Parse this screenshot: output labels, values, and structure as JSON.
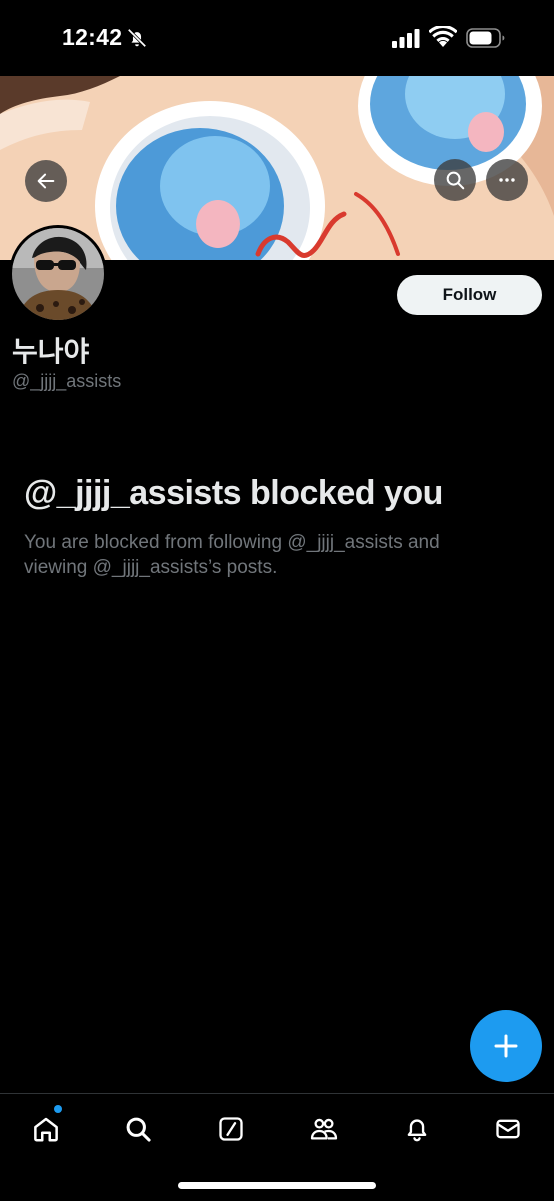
{
  "status_bar": {
    "time": "12:42",
    "icons": [
      "bell-off-icon",
      "cellular-signal-icon",
      "wifi-icon",
      "battery-icon"
    ]
  },
  "header": {
    "back_icon": "arrow-left-icon",
    "search_icon": "search-icon",
    "more_icon": "more-horizontal-icon"
  },
  "profile": {
    "display_name": "누나야",
    "handle": "@_jjjj_assists",
    "follow_label": "Follow"
  },
  "blocked": {
    "title": "@_jjjj_assists blocked you",
    "description": "You are blocked from following @_jjjj_assists and viewing @_jjjj_assists’s posts."
  },
  "fab": {
    "icon": "plus-icon"
  },
  "bottom_nav": {
    "items": [
      "home-icon",
      "search-icon",
      "grok-icon",
      "communities-icon",
      "notifications-icon",
      "messages-icon"
    ]
  },
  "colors": {
    "background": "#000000",
    "accent": "#1d9bf0",
    "primary_text": "#e7e9ea",
    "secondary_text": "#71767b",
    "follow_button": "#eff3f4"
  }
}
